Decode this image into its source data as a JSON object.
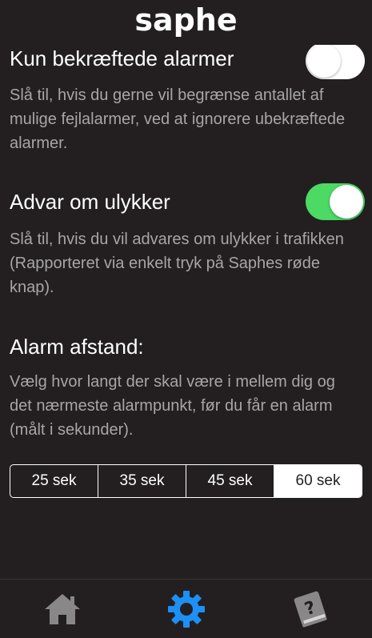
{
  "header": {
    "logo_text": "saphe"
  },
  "settings": {
    "confirmed_only": {
      "title": "Kun bekræftede alarmer",
      "description": "Slå til, hvis du gerne vil begrænse antallet af mulige fejlalarmer, ved at ignorere ubekræftede alarmer.",
      "enabled": false
    },
    "accident_warning": {
      "title": "Advar om ulykker",
      "description": "Slå til, hvis du vil advares om ulykker i trafikken (Rapporteret via enkelt tryk på Saphes røde knap).",
      "enabled": true
    },
    "alarm_distance": {
      "title": "Alarm afstand:",
      "description": "Vælg hvor langt der skal være i mellem dig og det nærmeste alarmpunkt, før du får en alarm (målt i sekunder).",
      "options": [
        "25 sek",
        "35 sek",
        "45 sek",
        "60 sek"
      ],
      "selected": "60 sek"
    }
  },
  "tabbar": {
    "items": [
      {
        "icon": "home-icon",
        "active": false
      },
      {
        "icon": "gear-icon",
        "active": true
      },
      {
        "icon": "help-book-icon",
        "active": false
      }
    ]
  },
  "colors": {
    "background": "#231f20",
    "toggle_on": "#4cd964",
    "active_tab": "#1e8ff5",
    "inactive_tab": "#8a8788",
    "muted_text": "#a7a5a6"
  }
}
